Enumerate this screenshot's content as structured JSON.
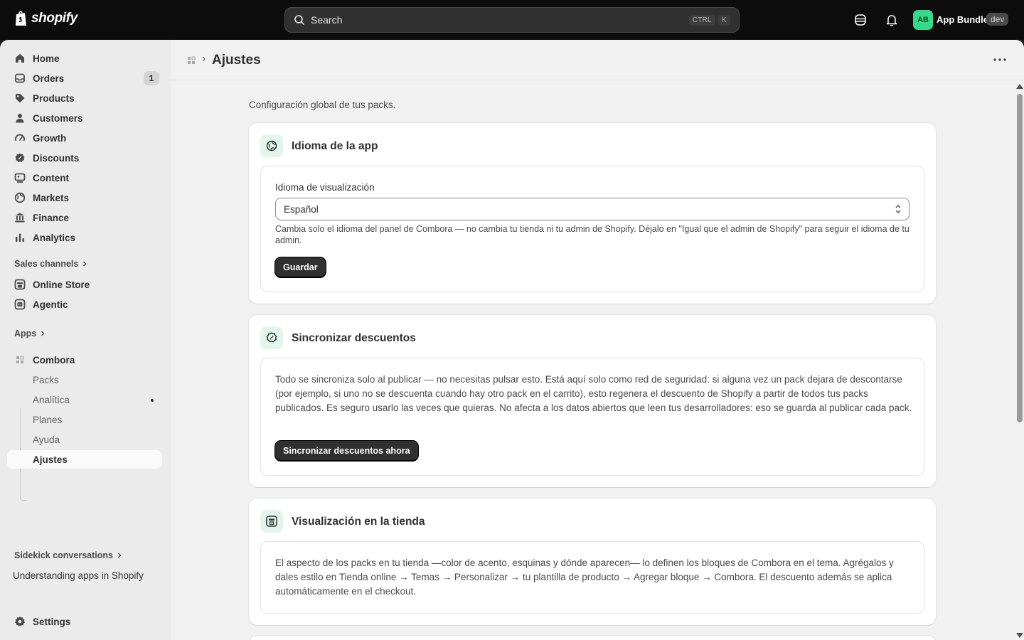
{
  "topbar": {
    "logo_text": "shopify",
    "search_placeholder": "Search",
    "shortcut_keys": [
      "CTRL",
      "K"
    ],
    "app_initials": "AB",
    "app_name": "App Bundle",
    "env_badge": "dev",
    "accent_color": "#36d98a"
  },
  "sidebar": {
    "nav": [
      {
        "label": "Home",
        "icon": "home-icon"
      },
      {
        "label": "Orders",
        "icon": "inbox-icon",
        "count": "1"
      },
      {
        "label": "Products",
        "icon": "tag-icon"
      },
      {
        "label": "Customers",
        "icon": "person-icon"
      },
      {
        "label": "Growth",
        "icon": "gauge-icon"
      },
      {
        "label": "Discounts",
        "icon": "discount-icon"
      },
      {
        "label": "Content",
        "icon": "content-icon"
      },
      {
        "label": "Markets",
        "icon": "globe-icon"
      },
      {
        "label": "Finance",
        "icon": "bank-icon"
      },
      {
        "label": "Analytics",
        "icon": "bar-chart-icon"
      }
    ],
    "sales_channels_label": "Sales channels",
    "channels": [
      {
        "label": "Online Store",
        "icon": "store-icon"
      },
      {
        "label": "Agentic",
        "icon": "agentic-icon"
      }
    ],
    "apps_label": "Apps",
    "app": {
      "label": "Combora",
      "icon": "app-grid-icon",
      "subitems": [
        "Packs",
        "Analítica",
        "Planes",
        "Ayuda",
        "Ajustes"
      ],
      "active": "Ajustes"
    },
    "sidekick_label": "Sidekick conversations",
    "sidekick_item": "Understanding apps in Shopify",
    "settings_label": "Settings"
  },
  "page": {
    "title": "Ajustes",
    "subtitle": "Configuración global de tus packs.",
    "cards": {
      "language": {
        "title": "Idioma de la app",
        "icon": "language-icon",
        "field_label": "Idioma de visualización",
        "selected_value": "Español",
        "help_text": "Cambia solo el idioma del panel de Combora — no cambia tu tienda ni tu admin de Shopify. Déjalo en \"Igual que el admin de Shopify\" para seguir el idioma de tu admin.",
        "button_label": "Guardar"
      },
      "sync": {
        "title": "Sincronizar descuentos",
        "icon": "sync-discount-icon",
        "body": "Todo se sincroniza solo al publicar — no necesitas pulsar esto. Está aquí solo como red de seguridad: si alguna vez un pack dejara de descontarse (por ejemplo, si uno no se descuenta cuando hay otro pack en el carrito), esto regenera el descuento de Shopify a partir de todos tus packs publicados. Es seguro usarlo las veces que quieras. No afecta a los datos abiertos que leen tus desarrolladores: eso se guarda al publicar cada pack.",
        "button_label": "Sincronizar descuentos ahora"
      },
      "storefront": {
        "title": "Visualización en la tienda",
        "icon": "storefront-icon",
        "body": "El aspecto de los packs en tu tienda —color de acento, esquinas y dónde aparecen— lo definen los bloques de Combora en el tema. Agrégalos y dales estilo en Tienda online → Temas → Personalizar → tu plantilla de producto → Agregar bloque → Combora. El descuento además se aplica automáticamente en el checkout."
      }
    }
  }
}
